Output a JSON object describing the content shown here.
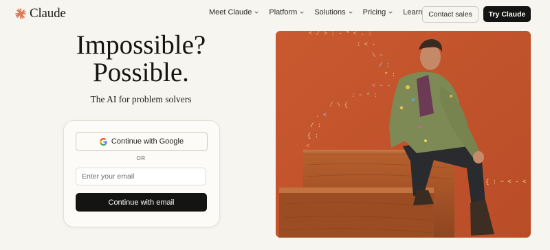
{
  "brand": {
    "name": "Claude",
    "accent": "#d97757"
  },
  "nav": {
    "items": [
      {
        "label": "Meet Claude"
      },
      {
        "label": "Platform"
      },
      {
        "label": "Solutions"
      },
      {
        "label": "Pricing"
      },
      {
        "label": "Learn"
      }
    ],
    "contact_label": "Contact sales",
    "try_label": "Try Claude"
  },
  "hero": {
    "line1": "Impossible?",
    "line2": "Possible.",
    "subtitle": "The AI for problem solvers"
  },
  "signup": {
    "google_label": "Continue with Google",
    "or_label": "OR",
    "email_placeholder": "Enter your email",
    "email_value": "",
    "email_button_label": "Continue with email"
  },
  "image": {
    "description_icon": "photo",
    "background_color": "#c4572e",
    "doodle_glyphs": [
      "<",
      "/",
      ">",
      ":",
      "-",
      "*",
      ".",
      "{",
      "}",
      "\\",
      "~"
    ],
    "code_snippet_near_knee": "{ :~<"
  }
}
